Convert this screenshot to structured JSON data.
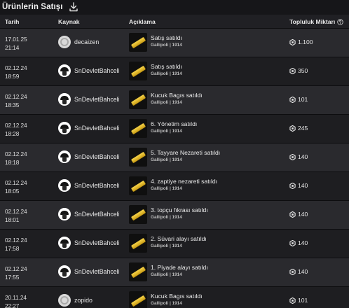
{
  "header": {
    "title": "Ürünlerin Satışı",
    "download_icon": "download-icon"
  },
  "columns": {
    "date": "Tarih",
    "source": "Kaynak",
    "description": "Açıklama",
    "amount": "Topluluk Miktarı",
    "amount_info_icon": "info-icon"
  },
  "colors": {
    "background": "#161619",
    "row_odd": "#2a2a2e",
    "row_even": "#1e1e21",
    "header_bg": "#202024",
    "item_gold": "#e8b923"
  },
  "rows": [
    {
      "date": "17.01.25",
      "time": "21:14",
      "user": "decaizen",
      "avatar": "plain-avatar",
      "item": "Satış satıldı",
      "game": "Gallipoli | 1914",
      "amount": "1.100"
    },
    {
      "date": "02.12.24",
      "time": "18:59",
      "user": "SnDevletBahceli",
      "avatar": "user-avatar",
      "item": "Satış satıldı",
      "game": "Gallipoli | 1914",
      "amount": "350"
    },
    {
      "date": "02.12.24",
      "time": "18:35",
      "user": "SnDevletBahceli",
      "avatar": "user-avatar",
      "item": "Kucuk Bagıs satıldı",
      "game": "Gallipoli | 1914",
      "amount": "101"
    },
    {
      "date": "02.12.24",
      "time": "18:28",
      "user": "SnDevletBahceli",
      "avatar": "user-avatar",
      "item": "6. Yönetim satıldı",
      "game": "Gallipoli | 1914",
      "amount": "245"
    },
    {
      "date": "02.12.24",
      "time": "18:18",
      "user": "SnDevletBahceli",
      "avatar": "user-avatar",
      "item": "5. Tayyare Nezareti satıldı",
      "game": "Gallipoli | 1914",
      "amount": "140"
    },
    {
      "date": "02.12.24",
      "time": "18:05",
      "user": "SnDevletBahceli",
      "avatar": "user-avatar",
      "item": "4. zaptiye nezareti satıldı",
      "game": "Gallipoli | 1914",
      "amount": "140"
    },
    {
      "date": "02.12.24",
      "time": "18:01",
      "user": "SnDevletBahceli",
      "avatar": "user-avatar",
      "item": "3. topçu fıkrası satıldı",
      "game": "Gallipoli | 1914",
      "amount": "140"
    },
    {
      "date": "02.12.24",
      "time": "17:58",
      "user": "SnDevletBahceli",
      "avatar": "user-avatar",
      "item": "2. Süvari alayı satıldı",
      "game": "Gallipoli | 1914",
      "amount": "140"
    },
    {
      "date": "02.12.24",
      "time": "17:55",
      "user": "SnDevletBahceli",
      "avatar": "user-avatar",
      "item": "1. Piyade alayı satıldı",
      "game": "Gallipoli | 1914",
      "amount": "140"
    },
    {
      "date": "20.11.24",
      "time": "22:27",
      "user": "zopido",
      "avatar": "plain-avatar",
      "item": "Kucuk Bagıs satıldı",
      "game": "Gallipoli | 1914",
      "amount": "101"
    }
  ]
}
